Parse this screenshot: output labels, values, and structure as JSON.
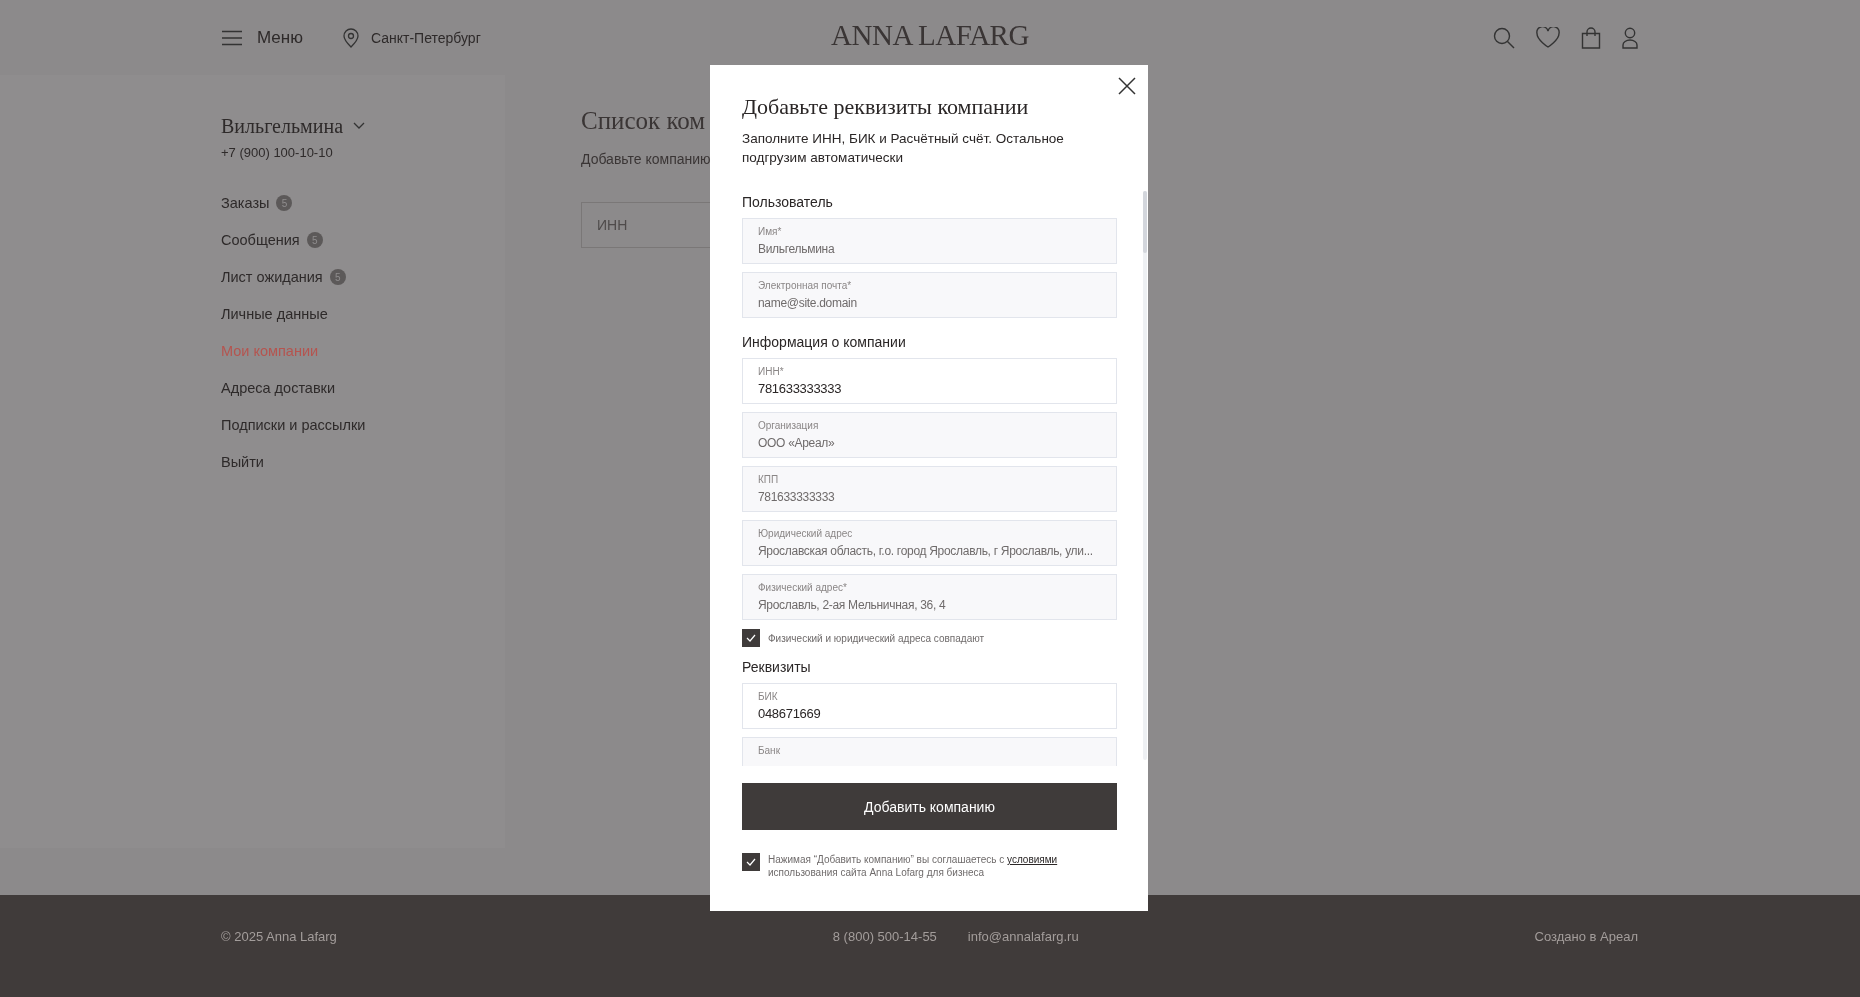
{
  "header": {
    "menu_label": "Меню",
    "city": "Санкт-Петербург",
    "logo": "ANNA LAFARG"
  },
  "account": {
    "name": "Вильгельмина",
    "phone": "+7 (900) 100-10-10"
  },
  "sidebar": {
    "items": [
      {
        "label": "Заказы",
        "badge": "5",
        "selected": false
      },
      {
        "label": "Сообщения",
        "badge": "5",
        "selected": false
      },
      {
        "label": "Лист ожидания",
        "badge": "5",
        "selected": false
      },
      {
        "label": "Личные данные",
        "selected": false
      },
      {
        "label": "Мои компании",
        "selected": true
      },
      {
        "label": "Адреса доставки",
        "selected": false
      },
      {
        "label": "Подписки и рассылки",
        "selected": false
      },
      {
        "label": "Выйти",
        "selected": false
      }
    ]
  },
  "page": {
    "title": "Список ком",
    "text": "Добавьте компанию",
    "inn_field": {
      "placeholder": "ИНН"
    }
  },
  "modal": {
    "title": "Добавьте реквизиты компании",
    "subtitle": "Заполните ИНН, БИК и Расчётный счёт. Остальное подгрузим автоматически",
    "sections": [
      {
        "heading": "Пользователь",
        "items": [
          {
            "kind": "field",
            "label": "Имя*",
            "value": "Вильгельмина",
            "editable": false
          },
          {
            "kind": "field",
            "label": "Электронная почта*",
            "value": "name@site.domain",
            "editable": false
          }
        ]
      },
      {
        "heading": "Информация о компании",
        "items": [
          {
            "kind": "field",
            "label": "ИНН*",
            "value": "781633333333",
            "editable": true
          },
          {
            "kind": "field",
            "label": "Организация",
            "value": "ООО «Ареал»",
            "editable": false
          },
          {
            "kind": "field",
            "label": "КПП",
            "value": "781633333333",
            "editable": false
          },
          {
            "kind": "field",
            "label": "Юридический адрес",
            "value": "Ярославская область, г.о. город Ярославль, г Ярославль, ули...",
            "editable": false
          },
          {
            "kind": "field",
            "label": "Физический адрес*",
            "value": "Ярославль, 2-ая Мельничная, 36, 4",
            "editable": false
          },
          {
            "kind": "checkbox",
            "label": "Физический и юридический адреса совпадают",
            "checked": true
          }
        ]
      },
      {
        "heading": "Реквизиты",
        "items": [
          {
            "kind": "field",
            "label": "БИК",
            "value": "048671669",
            "editable": true
          },
          {
            "kind": "field",
            "label": "Банк"
          }
        ]
      }
    ],
    "submit": "Добавить компанию",
    "consent": {
      "checked": true,
      "text": "Нажимая “Добавить компанию” вы соглашаетесь с",
      "link": "условиями",
      "text_after": "использования сайта Anna Lofarg для бизнеса"
    }
  },
  "footer": {
    "copyright": "© 2025 Anna Lafarg",
    "phone": "8 (800) 500-14-55",
    "email": "info@annalafarg.ru",
    "credit": "Создано в Ареал"
  }
}
